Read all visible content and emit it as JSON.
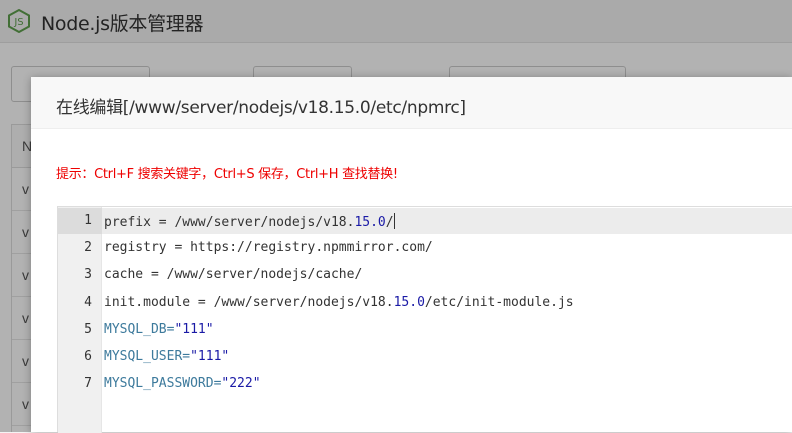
{
  "app": {
    "title": "Node.js版本管理器",
    "table_header": "N",
    "table_rows": [
      "v",
      "v",
      "v",
      "v",
      "v",
      "v"
    ]
  },
  "modal": {
    "title": "在线编辑[/www/server/nodejs/v18.15.0/etc/npmrc]",
    "tip": "提示：Ctrl+F 搜索关键字，Ctrl+S 保存，Ctrl+H 查找替换!"
  },
  "editor": {
    "active_line": 1,
    "lines": [
      {
        "num": "1",
        "parts": [
          {
            "t": "prefix = /www/server/nodejs/v18.",
            "c": ""
          },
          {
            "t": "15.0",
            "c": "num"
          },
          {
            "t": "/",
            "c": ""
          }
        ]
      },
      {
        "num": "2",
        "parts": [
          {
            "t": "registry = https://registry.npmmirror.com/",
            "c": ""
          }
        ]
      },
      {
        "num": "3",
        "parts": [
          {
            "t": "cache = /www/server/nodejs/cache/",
            "c": ""
          }
        ]
      },
      {
        "num": "4",
        "parts": [
          {
            "t": "init.module = /www/server/nodejs/v18.",
            "c": ""
          },
          {
            "t": "15.0",
            "c": "num"
          },
          {
            "t": "/etc/init-module.js",
            "c": ""
          }
        ]
      },
      {
        "num": "5",
        "parts": [
          {
            "t": "MYSQL_DB=",
            "c": "var"
          },
          {
            "t": "\"111\"",
            "c": "str"
          }
        ]
      },
      {
        "num": "6",
        "parts": [
          {
            "t": "MYSQL_USER=",
            "c": "var"
          },
          {
            "t": "\"111\"",
            "c": "str"
          }
        ]
      },
      {
        "num": "7",
        "parts": [
          {
            "t": "MYSQL_PASSWORD=",
            "c": "var"
          },
          {
            "t": "\"222\"",
            "c": "str"
          }
        ]
      }
    ]
  },
  "colors": {
    "tip": "#e00000",
    "number_token": "#1a1aa6",
    "variable_token": "#3d7a9c",
    "nodejs_green": "#5fa04e"
  },
  "icons": {
    "app_logo": "nodejs-logo-icon"
  }
}
